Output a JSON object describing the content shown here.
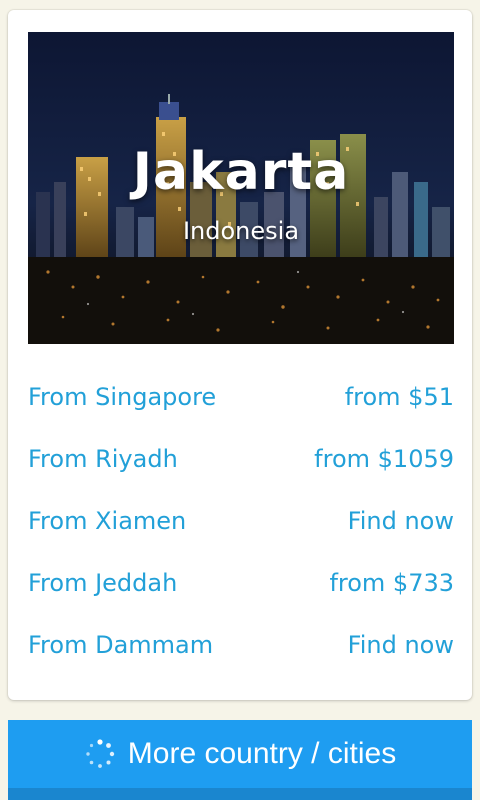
{
  "hero": {
    "city": "Jakarta",
    "country": "Indonesia"
  },
  "routes": [
    {
      "origin": "From Singapore",
      "price": "from $51"
    },
    {
      "origin": "From Riyadh",
      "price": "from $1059"
    },
    {
      "origin": "From Xiamen",
      "price": "Find now"
    },
    {
      "origin": "From Jeddah",
      "price": "from $733"
    },
    {
      "origin": "From Dammam",
      "price": "Find now"
    }
  ],
  "more_button": {
    "label": "More country / cities",
    "icon": "spinner-icon"
  },
  "colors": {
    "link": "#22a0d8",
    "button": "#1e9df1",
    "background": "#f6f4e8"
  }
}
